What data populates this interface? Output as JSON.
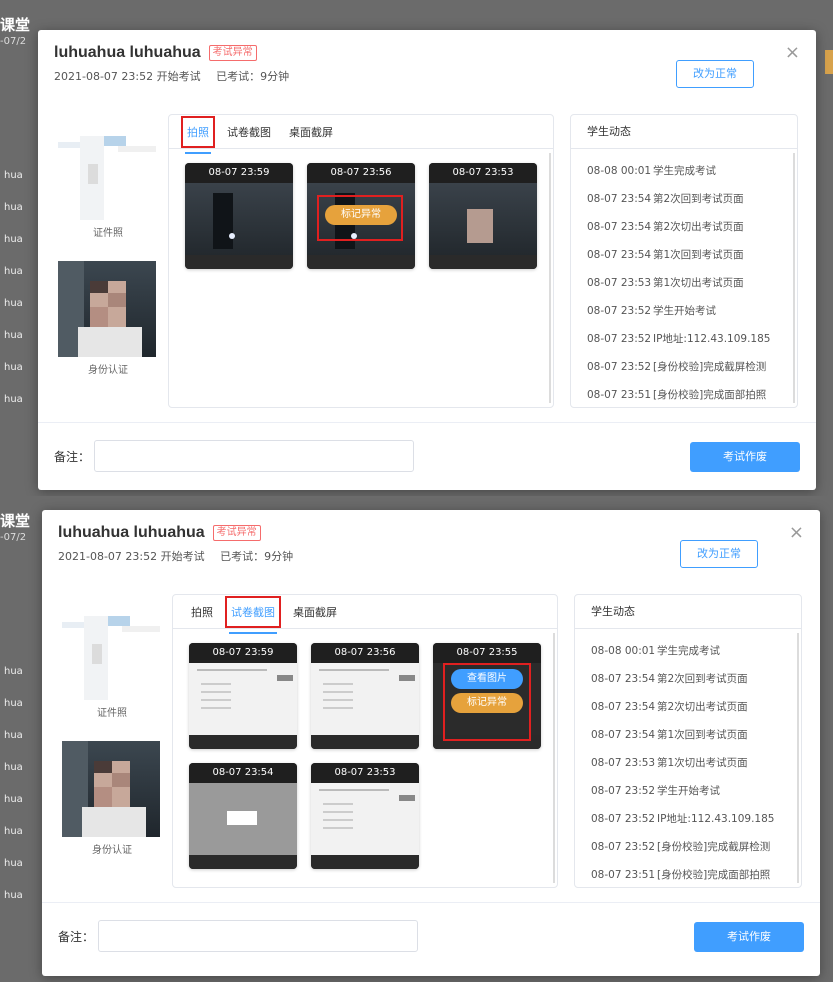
{
  "background": {
    "title": "课堂",
    "date": "-07/2",
    "rows": [
      "hua",
      "hua",
      "hua",
      "hua",
      "hua",
      "hua",
      "hua",
      "hua"
    ]
  },
  "modal": {
    "username": "luhuahua luhuahua",
    "status_tag": "考试异常",
    "start_time": "2021-08-07 23:52 开始考试",
    "duration": "已考试：9分钟",
    "mark_normal_button": "改为正常",
    "close_icon": "×",
    "id_photo_caption": "证件照",
    "id_verify_caption": "身份认证",
    "tabs": [
      "拍照",
      "试卷截图",
      "桌面截屏"
    ],
    "remark_label": "备注：",
    "remark_placeholder": "",
    "void_button": "考试作废"
  },
  "panel1": {
    "active_tab": "拍照",
    "photos": [
      {
        "time": "08-07 23:59"
      },
      {
        "time": "08-07 23:56",
        "action": "标记异常"
      },
      {
        "time": "08-07 23:53"
      }
    ]
  },
  "panel2": {
    "active_tab": "试卷截图",
    "screenshots": [
      {
        "time": "08-07 23:59"
      },
      {
        "time": "08-07 23:56"
      },
      {
        "time": "08-07 23:55",
        "view": "查看图片",
        "action": "标记异常"
      },
      {
        "time": "08-07 23:54"
      },
      {
        "time": "08-07 23:53"
      }
    ]
  },
  "activity": {
    "title": "学生动态",
    "items": [
      {
        "time": "08-08 00:01",
        "text": "学生完成考试"
      },
      {
        "time": "08-07 23:54",
        "text": "第2次回到考试页面"
      },
      {
        "time": "08-07 23:54",
        "text": "第2次切出考试页面"
      },
      {
        "time": "08-07 23:54",
        "text": "第1次回到考试页面"
      },
      {
        "time": "08-07 23:53",
        "text": "第1次切出考试页面"
      },
      {
        "time": "08-07 23:52",
        "text": "学生开始考试"
      },
      {
        "time": "08-07 23:52",
        "text": "IP地址:112.43.109.185"
      },
      {
        "time": "08-07 23:52",
        "text": "[身份校验]完成截屏检测"
      },
      {
        "time": "08-07 23:51",
        "text": "[身份校验]完成面部拍照"
      }
    ]
  },
  "colors": {
    "accent": "#409eff",
    "warning": "#e6a23c",
    "danger": "#f56c6c",
    "highlight_box": "#e02020"
  }
}
